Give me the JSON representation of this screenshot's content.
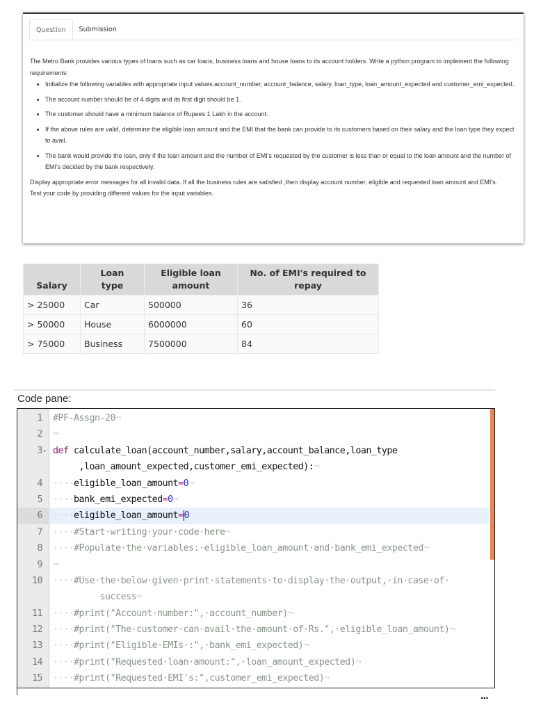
{
  "tabs": [
    "Question",
    "Submission"
  ],
  "question": {
    "intro": "The Metro Bank provides various types of loans such as car loans, business loans and house loans to its account holders. Write a python program to implement the following requirements:",
    "bullets": [
      "Initialize the following variables with appropriate input values:account_number, account_balance, salary, loan_type, loan_amount_expected and customer_emi_expected.",
      "The account number should be of 4 digits and its first digit should be 1.",
      "The customer should have a minimum balance of Rupees 1 Lakh in the account.",
      "If the above rules are valid, determine the eligible loan amount and the EMI that the bank can provide to its customers based on their salary and the loan type they expect to avail.",
      "The bank would provide the loan, only if the loan amount and the number of EMI's requested by the customer is less than or equal to the loan amount and the number of EMI's decided by the bank respectively."
    ],
    "outro1": "Display appropriate error messages for all invalid data. If all the business rules are satisfied ,then display account number, eligible and requested loan amount and EMI's.",
    "outro2": "Test your code by providing different values for the input variables."
  },
  "table": {
    "headers": [
      "Salary",
      "Loan type",
      "Eligible loan amount",
      "No. of EMI's required to repay"
    ],
    "rows": [
      [
        "> 25000",
        "Car",
        "500000",
        "36"
      ],
      [
        "> 50000",
        "House",
        "6000000",
        "60"
      ],
      [
        "> 75000",
        "Business",
        "7500000",
        "84"
      ]
    ]
  },
  "code_label": "Code pane:",
  "code_lines": [
    {
      "n": "1",
      "segs": [
        [
          "#PF-Assgn-20",
          "cm"
        ],
        [
          "¬",
          "ws"
        ]
      ]
    },
    {
      "n": "2",
      "segs": [
        [
          "¬",
          "ws"
        ]
      ]
    },
    {
      "n": "3",
      "fold": true,
      "segs": [
        [
          "def",
          "kw"
        ],
        [
          " calculate_loan(account_number,salary,account_balance,loan_type",
          ""
        ]
      ]
    },
    {
      "n": "",
      "segs": [
        [
          "     ,loan_amount_expected,customer_emi_expected):",
          ""
        ],
        [
          "¬",
          "ws"
        ]
      ]
    },
    {
      "n": "4",
      "segs": [
        [
          "····",
          "ws"
        ],
        [
          "eligible_loan_amount",
          ""
        ],
        [
          "=",
          "op"
        ],
        [
          "0",
          "num"
        ],
        [
          "¬",
          "ws"
        ]
      ]
    },
    {
      "n": "5",
      "segs": [
        [
          "····",
          "ws"
        ],
        [
          "bank_emi_expected",
          ""
        ],
        [
          "=",
          "op"
        ],
        [
          "0",
          "num"
        ],
        [
          "¬",
          "ws"
        ]
      ]
    },
    {
      "n": "6",
      "active": true,
      "segs": [
        [
          "····",
          "ws"
        ],
        [
          "eligible_loan_amount",
          ""
        ],
        [
          "=",
          "op"
        ],
        [
          "0",
          "num cursor"
        ]
      ]
    },
    {
      "n": "7",
      "segs": [
        [
          "····",
          "ws"
        ],
        [
          "#Start·writing·your·code·here",
          "cm"
        ],
        [
          "¬",
          "ws"
        ]
      ]
    },
    {
      "n": "8",
      "segs": [
        [
          "····",
          "ws"
        ],
        [
          "#Populate·the·variables:·eligible_loan_amount·and·bank_emi_expected",
          "cm"
        ],
        [
          "¬",
          "ws"
        ]
      ]
    },
    {
      "n": "9",
      "segs": [
        [
          "¬",
          "ws"
        ]
      ]
    },
    {
      "n": "10",
      "segs": [
        [
          "····",
          "ws"
        ],
        [
          "#Use·the·below·given·print·statements·to·display·the·output,·in·case·of·",
          "cm"
        ]
      ]
    },
    {
      "n": "",
      "segs": [
        [
          "         success",
          "cm"
        ],
        [
          "¬",
          "ws"
        ]
      ]
    },
    {
      "n": "11",
      "segs": [
        [
          "····",
          "ws"
        ],
        [
          "#print(\"Account·number:\",·account_number)",
          "cm"
        ],
        [
          "¬",
          "ws"
        ]
      ]
    },
    {
      "n": "12",
      "segs": [
        [
          "····",
          "ws"
        ],
        [
          "#print(\"The·customer·can·avail·the·amount·of·Rs.\",·eligible_loan_amount)",
          "cm"
        ],
        [
          "¬",
          "ws"
        ]
      ]
    },
    {
      "n": "13",
      "segs": [
        [
          "····",
          "ws"
        ],
        [
          "#print(\"Eligible·EMIs·:\",·bank_emi_expected)",
          "cm"
        ],
        [
          "¬",
          "ws"
        ]
      ]
    },
    {
      "n": "14",
      "segs": [
        [
          "····",
          "ws"
        ],
        [
          "#print(\"Requested·loan·amount:\",·loan_amount_expected)",
          "cm"
        ],
        [
          "¬",
          "ws"
        ]
      ]
    },
    {
      "n": "15",
      "segs": [
        [
          "····",
          "ws"
        ],
        [
          "#print(\"Requested·EMI's:\",customer_emi_expected)",
          "cm"
        ],
        [
          "¬",
          "ws"
        ]
      ]
    }
  ],
  "more_label": "..."
}
